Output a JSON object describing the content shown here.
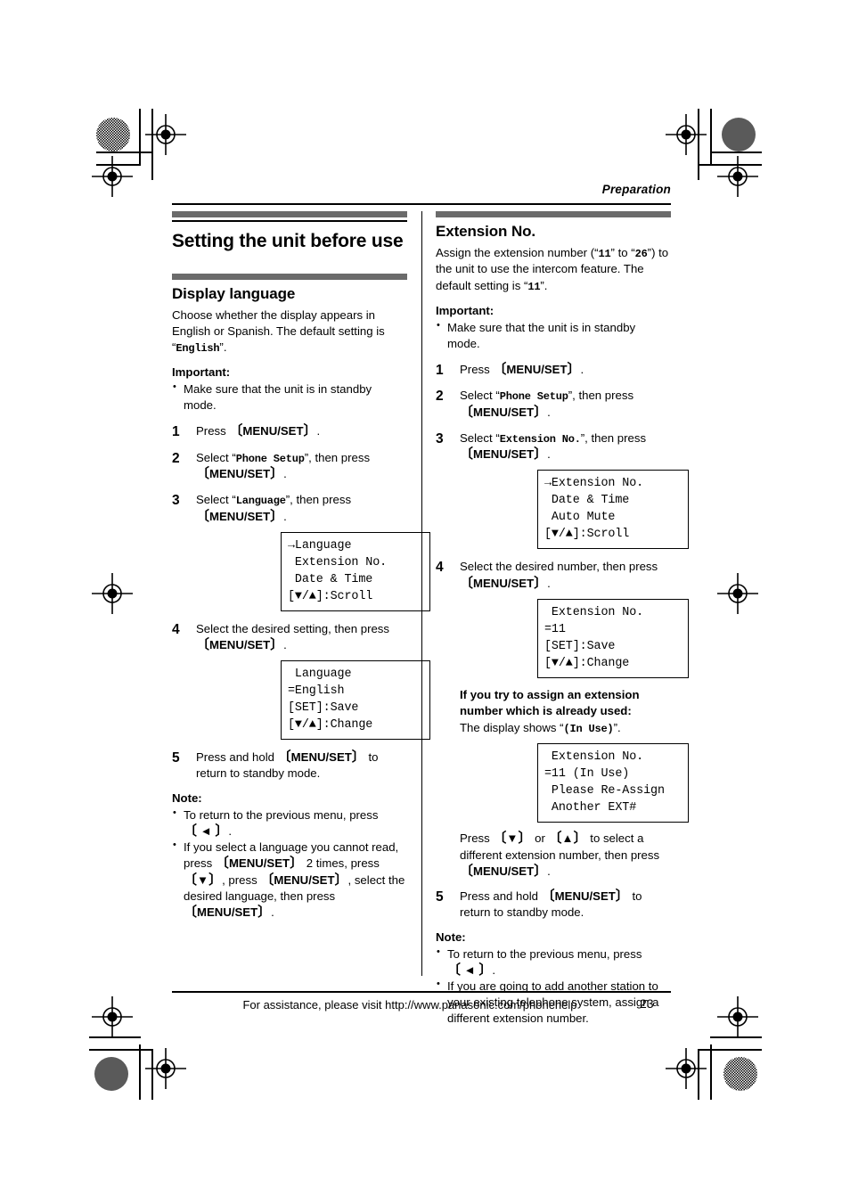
{
  "page": {
    "running_head": "Preparation",
    "page_number": "23",
    "footer_text": "For assistance, please visit http://www.panasonic.com/phonehelp"
  },
  "left_column": {
    "chapter_title": "Setting the unit before use",
    "section_title": "Display language",
    "intro": "Choose whether the display appears in English or Spanish. The default setting is “English”.",
    "intro_parts": {
      "a": "Choose whether the display appears in English or Spanish. The default setting is “",
      "mono": "English",
      "b": "”."
    },
    "important_label": "Important:",
    "important_bullets": [
      "Make sure that the unit is in standby mode."
    ],
    "steps": [
      {
        "num": "1",
        "parts": [
          {
            "t": "Press ",
            "k": false
          },
          {
            "t": "[MENU/SET]",
            "k": true
          },
          {
            "t": ".",
            "k": false
          }
        ]
      },
      {
        "num": "2",
        "parts": [
          {
            "t": "Select “",
            "k": false
          },
          {
            "t": "Phone Setup",
            "m": true
          },
          {
            "t": "”, then press ",
            "k": false
          },
          {
            "t": "[MENU/SET]",
            "k": true
          },
          {
            "t": ".",
            "k": false
          }
        ]
      },
      {
        "num": "3",
        "parts": [
          {
            "t": "Select “",
            "k": false
          },
          {
            "t": "Language",
            "m": true
          },
          {
            "t": "”, then press ",
            "k": false
          },
          {
            "t": "[MENU/SET]",
            "k": true
          },
          {
            "t": ".",
            "k": false
          }
        ]
      },
      {
        "num": "4",
        "parts": [
          {
            "t": "Select the desired setting, then press ",
            "k": false
          },
          {
            "t": "[MENU/SET]",
            "k": true
          },
          {
            "t": ".",
            "k": false
          }
        ]
      },
      {
        "num": "5",
        "parts": [
          {
            "t": "Press and hold ",
            "k": false
          },
          {
            "t": "[MENU/SET]",
            "k": true
          },
          {
            "t": " to return to standby mode.",
            "k": false
          }
        ]
      }
    ],
    "lcd_menu": "→Language\n Extension No.\n Date & Time\n[▼/▲]:Scroll",
    "lcd_setting": " Language\n=English\n[SET]:Save\n[▼/▲]:Change",
    "note_label": "Note:",
    "note_bullets": [
      {
        "parts": [
          {
            "t": "To return to the previous menu, press ",
            "k": false
          },
          {
            "t": "[◄]",
            "k": true
          },
          {
            "t": ".",
            "k": false
          }
        ]
      },
      {
        "parts": [
          {
            "t": "If you select a language you cannot read, press ",
            "k": false
          },
          {
            "t": "[MENU/SET]",
            "k": true
          },
          {
            "t": " 2 times, press ",
            "k": false
          },
          {
            "t": "[▼]",
            "k": true
          },
          {
            "t": ", press ",
            "k": false
          },
          {
            "t": "[MENU/SET]",
            "k": true
          },
          {
            "t": ", select the desired language, then press ",
            "k": false
          },
          {
            "t": "[MENU/SET]",
            "k": true
          },
          {
            "t": ".",
            "k": false
          }
        ]
      }
    ]
  },
  "right_column": {
    "section_title": "Extension No.",
    "intro_parts": {
      "a": "Assign the extension number (“",
      "mono1": "11",
      "b": "” to “",
      "mono2": "26",
      "c": "”) to the unit to use the intercom feature. The default setting is “",
      "mono3": "11",
      "d": "”."
    },
    "important_label": "Important:",
    "important_bullets": [
      "Make sure that the unit is in standby mode."
    ],
    "steps": [
      {
        "num": "1",
        "parts": [
          {
            "t": "Press ",
            "k": false
          },
          {
            "t": "[MENU/SET]",
            "k": true
          },
          {
            "t": ".",
            "k": false
          }
        ]
      },
      {
        "num": "2",
        "parts": [
          {
            "t": "Select “",
            "k": false
          },
          {
            "t": "Phone Setup",
            "m": true
          },
          {
            "t": "”, then press ",
            "k": false
          },
          {
            "t": "[MENU/SET]",
            "k": true
          },
          {
            "t": ".",
            "k": false
          }
        ]
      },
      {
        "num": "3",
        "parts": [
          {
            "t": "Select “",
            "k": false
          },
          {
            "t": "Extension No.",
            "m": true
          },
          {
            "t": "”, then press ",
            "k": false
          },
          {
            "t": "[MENU/SET]",
            "k": true
          },
          {
            "t": ".",
            "k": false
          }
        ]
      },
      {
        "num": "4",
        "parts": [
          {
            "t": "Select the desired number, then press ",
            "k": false
          },
          {
            "t": "[MENU/SET]",
            "k": true
          },
          {
            "t": ".",
            "k": false
          }
        ]
      },
      {
        "num": "5",
        "parts": [
          {
            "t": "Press and hold ",
            "k": false
          },
          {
            "t": "[MENU/SET]",
            "k": true
          },
          {
            "t": " to return to standby mode.",
            "k": false
          }
        ]
      }
    ],
    "lcd_menu": "→Extension No.\n Date & Time\n Auto Mute\n[▼/▲]:Scroll",
    "lcd_setting": " Extension No.\n=11\n[SET]:Save\n[▼/▲]:Change",
    "inuse_heading": "If you try to assign an extension number which is already used:",
    "inuse_text_parts": {
      "a": "The display shows “",
      "mono": "(In Use)",
      "b": "”."
    },
    "lcd_inuse": " Extension No.\n=11 (In Use)\n Please Re-Assign\n Another EXT#",
    "inuse_after": {
      "parts": [
        {
          "t": "Press ",
          "k": false
        },
        {
          "t": "[▼]",
          "k": true
        },
        {
          "t": " or ",
          "k": false
        },
        {
          "t": "[▲]",
          "k": true
        },
        {
          "t": " to select a different extension number, then press ",
          "k": false
        },
        {
          "t": "[MENU/SET]",
          "k": true
        },
        {
          "t": ".",
          "k": false
        }
      ]
    },
    "note_label": "Note:",
    "note_bullets": [
      {
        "parts": [
          {
            "t": "To return to the previous menu, press ",
            "k": false
          },
          {
            "t": "[◄]",
            "k": true
          },
          {
            "t": ".",
            "k": false
          }
        ]
      },
      {
        "parts": [
          {
            "t": "If you are going to add another station to your existing telephone system, assign a different extension number.",
            "k": false
          }
        ]
      }
    ]
  },
  "colors": {
    "section_bar": "#6b6b6b",
    "text": "#000000",
    "page_background": "#ffffff"
  }
}
